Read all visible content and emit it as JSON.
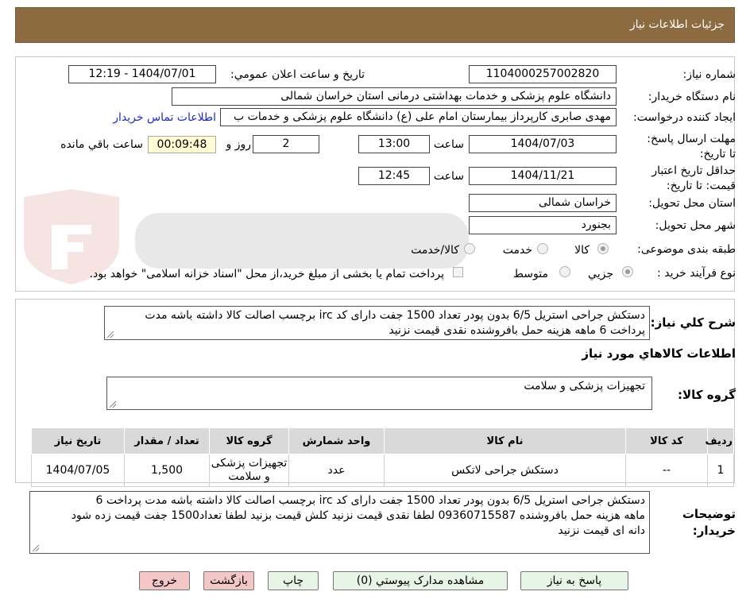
{
  "header": {
    "title": "جزئیات اطلاعات نیاز"
  },
  "form": {
    "need_number_label": "شماره نیاز:",
    "need_number": "1104000257002820",
    "announce_label": "تاریخ و ساعت اعلان عمومي:",
    "announce_value": "1404/07/01 - 12:19",
    "buyer_org_label": "نام دستگاه خريدار:",
    "buyer_org": "دانشگاه علوم پزشکی و خدمات بهداشتی درمانی استان خراسان شمالی",
    "requester_label": "ايجاد کننده درخواست:",
    "requester": "مهدی صابری کارپرداز بیمارستان امام علی (ع) دانشگاه علوم پزشکی و خدمات ب",
    "contact_link": "اطلاعات تماس خريدار",
    "deadline_label": "مهلت ارسال پاسخ: تا تاریخ:",
    "deadline_date": "1404/07/03",
    "time_label": "ساعت",
    "deadline_time": "13:00",
    "days_value": "2",
    "days_label": "روز و",
    "remaining_time": "00:09:48",
    "remaining_label": "ساعت باقي مانده",
    "validity_label": "حداقل تاريخ اعتبار قيمت: تا تاریخ:",
    "validity_date": "1404/11/21",
    "validity_time": "12:45",
    "province_label": "استان محل تحويل:",
    "province": "خراسان شمالی",
    "city_label": "شهر محل تحويل:",
    "city": "بجنورد",
    "category_label": "طبقه بندی موضوعی:",
    "category_options": [
      "کالا",
      "خدمت",
      "کالا/خدمت"
    ],
    "process_label": "نوع فرآیند خرید :",
    "process_options": [
      "جزیي",
      "متوسط"
    ],
    "payment_note": "پرداخت تمام یا بخشی از مبلغ خرید،از محل \"اسناد خزانه اسلامی\" خواهد بود."
  },
  "summary": {
    "label": "شرح کلي نياز:",
    "line1": "دستکش جراحی استریل 6/5 بدون پودر تعداد 1500 جفت دارای کد irc برچسب اصالت کالا داشته باشه مدت",
    "line2": "پرداخت 6 ماهه هزینه حمل بافروشنده نقدی قیمت نزنید"
  },
  "goods": {
    "section_title": "اطلاعات کالاهاي مورد نياز",
    "group_label": "گروه کالا:",
    "group_value": "تجهیزات پزشکی و سلامت",
    "columns": [
      "رديف",
      "کد کالا",
      "نام کالا",
      "واحد شمارش",
      "گروه کالا",
      "تعداد / مقدار",
      "تاریخ نیاز"
    ],
    "rows": [
      [
        "1",
        "--",
        "دستکش جراحی لاتکس",
        "عدد",
        "تجهیزات پزشکی و سلامت",
        "1,500",
        "1404/07/05"
      ]
    ]
  },
  "buyer_notes": {
    "label": "توضيحات خريدار:",
    "line1": "دستکش جراحی استریل 6/5 بدون پودر تعداد 1500 جفت دارای کد irc برچسب اصالت کالا داشته باشه مدت پرداخت 6",
    "line2": "ماهه هزینه حمل بافروشنده 09360715587 لطفا نقدی قیمت نزنید کلش قیمت بزنید  لطفا تعداد1500 جفت قیمت زده شود",
    "line3": "دانه ای قیمت نزنید"
  },
  "buttons": {
    "reply": "پاسخ به نیاز",
    "attachments": "مشاهده مدارک پیوستي (0)",
    "print": "چاپ",
    "back": "بازگشت",
    "exit": "خروج"
  },
  "colors": {
    "header_bg": "#8b6b3f",
    "green_button": "#e6f5e6",
    "red_button": "#f4c7c7",
    "link": "#1a2bd6"
  }
}
